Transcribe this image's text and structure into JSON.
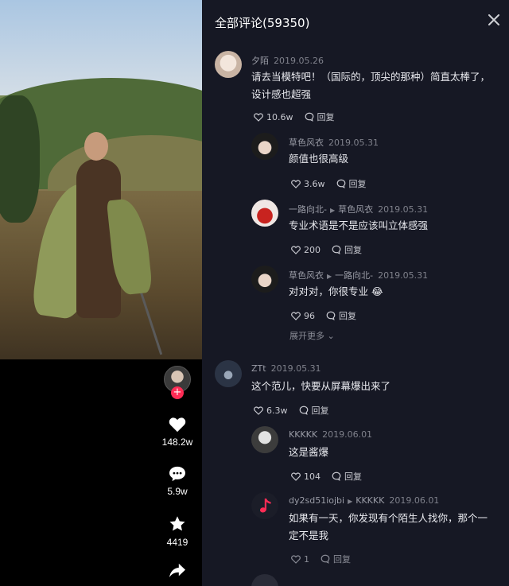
{
  "video": {
    "likes": "148.2w",
    "comments": "5.9w",
    "favorites": "4419",
    "follow_badge": "+"
  },
  "panel": {
    "title": "全部评论(59350)"
  },
  "comments": [
    {
      "author": "夕陌",
      "date": "2019.05.26",
      "text": "请去当模特吧！（国际的，顶尖的那种）简直太棒了，设计感也超强",
      "likes": "10.6w",
      "reply": "回复"
    },
    {
      "author": "草色风衣",
      "date": "2019.05.31",
      "text": "颜值也很高级",
      "likes": "3.6w",
      "reply": "回复"
    },
    {
      "author": "一路向北-",
      "reply_to": "草色风衣",
      "date": "2019.05.31",
      "text": "专业术语是不是应该叫立体感强",
      "likes": "200",
      "reply": "回复"
    },
    {
      "author": "草色风衣",
      "reply_to": "一路向北-",
      "date": "2019.05.31",
      "text": "对对对，你很专业",
      "emoji": "😂",
      "likes": "96",
      "reply": "回复"
    },
    {
      "author": "ZTt",
      "date": "2019.05.31",
      "text": "这个范儿，快要从屏幕爆出来了",
      "likes": "6.3w",
      "reply": "回复"
    },
    {
      "author": "KKKKK",
      "date": "2019.06.01",
      "text": "这是酱爆",
      "likes": "104",
      "reply": "回复"
    },
    {
      "author": "dy2sd51iojbi",
      "reply_to": "KKKKK",
      "date": "2019.06.01",
      "text": "如果有一天，你发现有个陌生人找你，那个一定不是我",
      "likes": "1",
      "reply": "回复"
    }
  ],
  "expand_more": "展开更多",
  "colors": {
    "panel_bg": "#161824",
    "accent": "#fe2c55",
    "muted_text": "#9a9ca6"
  }
}
